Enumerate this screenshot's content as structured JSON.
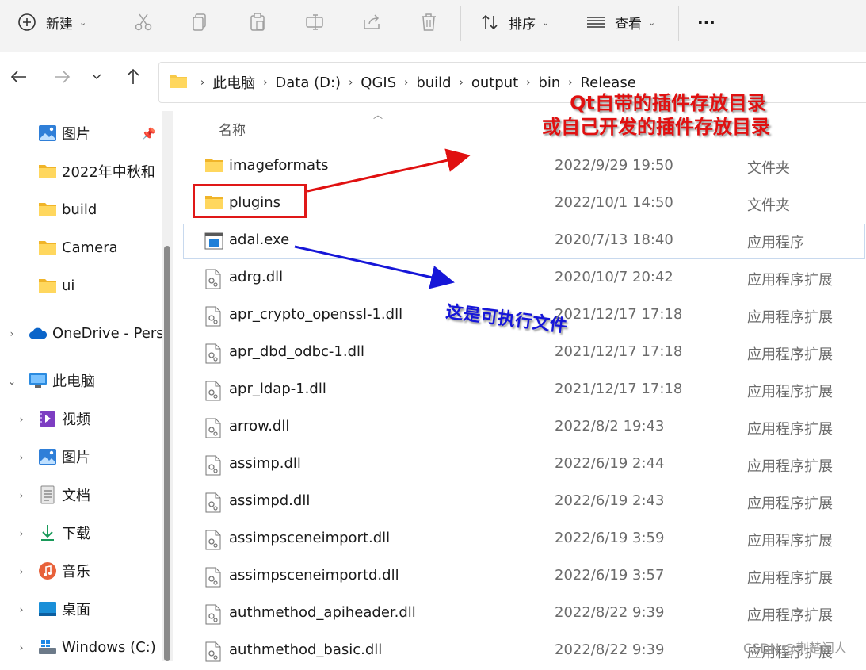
{
  "toolbar": {
    "new_label": "新建",
    "sort_label": "排序",
    "view_label": "查看",
    "more_label": "···"
  },
  "address": {
    "crumbs": [
      "此电脑",
      "Data (D:)",
      "QGIS",
      "build",
      "output",
      "bin",
      "Release"
    ]
  },
  "sidebar": {
    "quick": [
      {
        "label": "图片",
        "icon": "pictures-icon"
      },
      {
        "label": "2022年中秋和",
        "icon": "folder-icon"
      },
      {
        "label": "build",
        "icon": "folder-icon"
      },
      {
        "label": "Camera",
        "icon": "folder-icon"
      },
      {
        "label": "ui",
        "icon": "folder-icon"
      }
    ],
    "onedrive": "OneDrive - Pers",
    "thispc": "此电脑",
    "pc_items": [
      {
        "label": "视频",
        "icon": "videos-icon"
      },
      {
        "label": "图片",
        "icon": "pictures-icon"
      },
      {
        "label": "文档",
        "icon": "documents-icon"
      },
      {
        "label": "下载",
        "icon": "downloads-icon"
      },
      {
        "label": "音乐",
        "icon": "music-icon"
      },
      {
        "label": "桌面",
        "icon": "desktop-icon"
      },
      {
        "label": "Windows (C:)",
        "icon": "drive-icon"
      }
    ]
  },
  "list": {
    "header_name": "名称",
    "rows": [
      {
        "name": "imageformats",
        "date": "2022/9/29 19:50",
        "type": "文件夹",
        "icon": "folder-icon"
      },
      {
        "name": "plugins",
        "date": "2022/10/1 14:50",
        "type": "文件夹",
        "icon": "folder-icon"
      },
      {
        "name": "adal.exe",
        "date": "2020/7/13 18:40",
        "type": "应用程序",
        "icon": "exe-icon"
      },
      {
        "name": "adrg.dll",
        "date": "2020/10/7 20:42",
        "type": "应用程序扩展",
        "icon": "dll-icon"
      },
      {
        "name": "apr_crypto_openssl-1.dll",
        "date": "2021/12/17 17:18",
        "type": "应用程序扩展",
        "icon": "dll-icon"
      },
      {
        "name": "apr_dbd_odbc-1.dll",
        "date": "2021/12/17 17:18",
        "type": "应用程序扩展",
        "icon": "dll-icon"
      },
      {
        "name": "apr_ldap-1.dll",
        "date": "2021/12/17 17:18",
        "type": "应用程序扩展",
        "icon": "dll-icon"
      },
      {
        "name": "arrow.dll",
        "date": "2022/8/2 19:43",
        "type": "应用程序扩展",
        "icon": "dll-icon"
      },
      {
        "name": "assimp.dll",
        "date": "2022/6/19 2:44",
        "type": "应用程序扩展",
        "icon": "dll-icon"
      },
      {
        "name": "assimpd.dll",
        "date": "2022/6/19 2:43",
        "type": "应用程序扩展",
        "icon": "dll-icon"
      },
      {
        "name": "assimpsceneimport.dll",
        "date": "2022/6/19 3:59",
        "type": "应用程序扩展",
        "icon": "dll-icon"
      },
      {
        "name": "assimpsceneimportd.dll",
        "date": "2022/6/19 3:57",
        "type": "应用程序扩展",
        "icon": "dll-icon"
      },
      {
        "name": "authmethod_apiheader.dll",
        "date": "2022/8/22 9:39",
        "type": "应用程序扩展",
        "icon": "dll-icon"
      },
      {
        "name": "authmethod_basic.dll",
        "date": "2022/8/22 9:39",
        "type": "应用程序扩展",
        "icon": "dll-icon"
      }
    ]
  },
  "annotations": {
    "red_line1": "Qt自带的插件存放目录",
    "red_line2": "或自己开发的插件存放目录",
    "blue": "这是可执行文件",
    "red_color": "#e01010",
    "blue_color": "#1616d8"
  },
  "watermark": "CSDN @荆楚闲人"
}
